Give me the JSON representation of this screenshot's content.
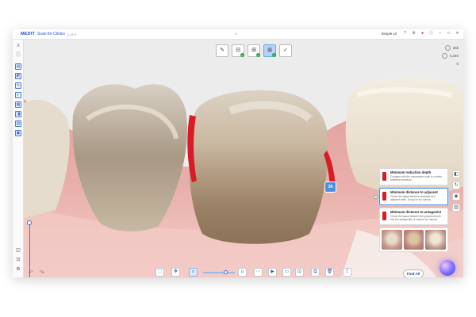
{
  "titlebar": {
    "logo": "MEDIT",
    "app_name": "Scan for Clinics",
    "version": "1.14.0",
    "filename": "1/",
    "mode": "Simple UI",
    "icons": [
      "help-icon",
      "settings-icon",
      "record-icon",
      "window-icons"
    ]
  },
  "left_toolbar": {
    "icons": [
      "menu-icon",
      "case-icon",
      "scan-icon",
      "chat-icon",
      "tooth-icon",
      "bite-icon",
      "layer-icon",
      "measure-icon",
      "grid-icon",
      "lock-icon",
      "display-icon",
      "settings-icon"
    ]
  },
  "top_tools": {
    "icons": [
      "edit-icon",
      "adjacent-icon",
      "antagonist-icon",
      "preparation-icon",
      "check-icon"
    ],
    "active_index": 3
  },
  "view_info": {
    "value1": "25k",
    "value2": "4,240",
    "value3": "0"
  },
  "tooth_label": "36",
  "right_strip_icons": [
    "color-icon",
    "rotate-icon",
    "chrome-icon",
    "layers-icon"
  ],
  "checks": [
    {
      "title": "Minimum reduction depth",
      "desc": "Compare with the unprepared tooth to confirm sufficient reduction.",
      "selected": false
    },
    {
      "title": "Minimum distance to adjacent",
      "desc": "Check the space between prepared and adjacent teeth. It may be too narrow.",
      "selected": true
    },
    {
      "title": "Minimum distance to antagonist",
      "desc": "Check the space between the prepared tooth and the antagonists. It may be too narrow.",
      "selected": false
    }
  ],
  "find_all_label": "Find All",
  "colors": {
    "accent": "#3b73d6",
    "alert_red": "#d91b25",
    "gum": "#e79c9b",
    "tooth": "#e9dcc8"
  },
  "bottom_tools": [
    "undo-icon",
    "redo-icon",
    "view-3d-icon",
    "lasso-icon",
    "zoom-icon",
    "scale-icon",
    "magnet-icon",
    "brush-icon",
    "play-icon",
    "compare-icon",
    "bite-icon",
    "trash-icon",
    "align-icon",
    "export-icon"
  ]
}
